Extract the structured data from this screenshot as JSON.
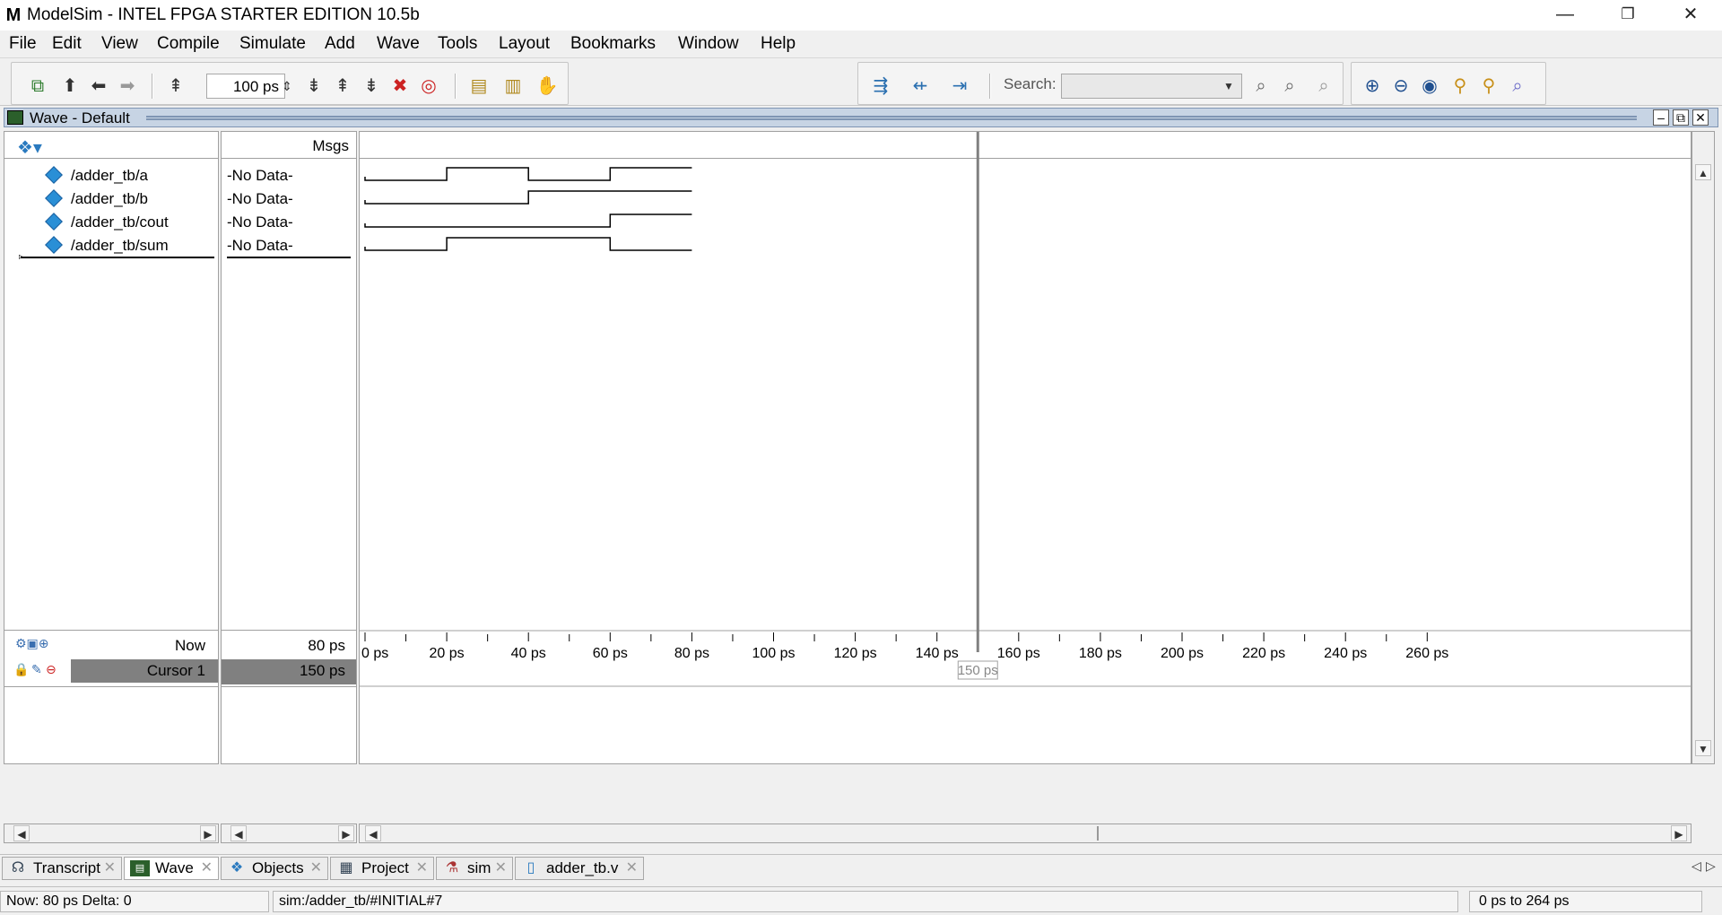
{
  "window": {
    "title": "ModelSim - INTEL FPGA STARTER EDITION 10.5b",
    "logo": "M",
    "minimize": "—",
    "restore": "❐",
    "close": "✕"
  },
  "menu": [
    "File",
    "Edit",
    "View",
    "Compile",
    "Simulate",
    "Add",
    "Wave",
    "Tools",
    "Layout",
    "Bookmarks",
    "Window",
    "Help"
  ],
  "toolbar": {
    "run_length": "100 ps",
    "search_label": "Search:",
    "search_value": ""
  },
  "pane": {
    "title": "Wave - Default"
  },
  "columns": {
    "msgs_header": "Msgs"
  },
  "signals": [
    {
      "name": "/adder_tb/a",
      "value": "-No Data-",
      "transitions": [
        0,
        20,
        40,
        60,
        80
      ],
      "levels": [
        0,
        1,
        0,
        1
      ]
    },
    {
      "name": "/adder_tb/b",
      "value": "-No Data-",
      "transitions": [
        0,
        40,
        80
      ],
      "levels": [
        0,
        1
      ]
    },
    {
      "name": "/adder_tb/cout",
      "value": "-No Data-",
      "transitions": [
        0,
        60,
        80
      ],
      "levels": [
        0,
        1
      ]
    },
    {
      "name": "/adder_tb/sum",
      "value": "-No Data-",
      "transitions": [
        0,
        20,
        60,
        80
      ],
      "levels": [
        0,
        1,
        0
      ]
    }
  ],
  "timeline": {
    "now_label": "Now",
    "now_value": "80 ps",
    "cursor_label": "Cursor 1",
    "cursor_value": "150 ps",
    "cursor_marker": "150 ps",
    "cursor_time": 150,
    "tick_labels": [
      "0 ps",
      "20 ps",
      "40 ps",
      "60 ps",
      "80 ps",
      "100 ps",
      "120 ps",
      "140 ps",
      "160 ps",
      "180 ps",
      "200 ps",
      "220 ps",
      "240 ps",
      "260 ps"
    ],
    "range_ps": [
      0,
      264
    ]
  },
  "tabs": [
    {
      "label": "Transcript",
      "icon": "transcript-icon",
      "active": false
    },
    {
      "label": "Wave",
      "icon": "wave-icon",
      "active": true
    },
    {
      "label": "Objects",
      "icon": "objects-icon",
      "active": false
    },
    {
      "label": "Project",
      "icon": "project-icon",
      "active": false
    },
    {
      "label": "sim",
      "icon": "sim-icon",
      "active": false
    },
    {
      "label": "adder_tb.v",
      "icon": "file-icon",
      "active": false
    }
  ],
  "status": {
    "now": "Now: 80 ps  Delta: 0",
    "context": "sim:/adder_tb/#INITIAL#7",
    "range": "0 ps to 264 ps"
  },
  "colors": {
    "pane_header": "#c7d4e4",
    "signal_diamond": "#2a8fd6",
    "cursor_row": "#808080",
    "cursor_line": "#808080"
  }
}
